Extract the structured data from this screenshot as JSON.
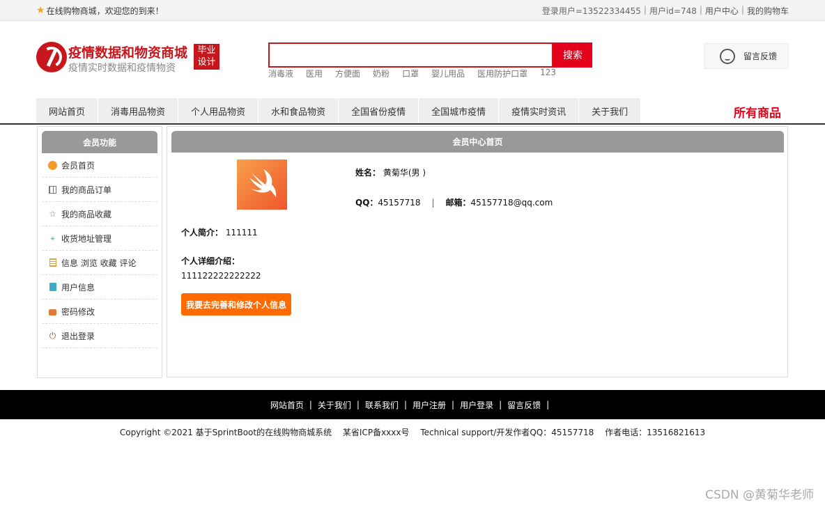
{
  "topbar": {
    "welcome": "在线购物商城，欢迎您的到来！",
    "login_user": "登录用户=13522334455",
    "user_id": "用户id=748",
    "user_center": "用户中心",
    "cart": "我的购物车"
  },
  "header": {
    "title": "疫情数据和物资商城",
    "subtitle": "疫情实时数据和疫情物资",
    "badge_line1": "毕业",
    "badge_line2": "设计",
    "search_placeholder": "",
    "search_button": "搜索",
    "hotwords": [
      "消毒液",
      "医用",
      "方便面",
      "奶粉",
      "口罩",
      "婴儿用品",
      "医用防护口罩",
      "123"
    ],
    "feedback": "留言反馈"
  },
  "nav": {
    "items": [
      "网站首页",
      "消毒用品物资",
      "个人用品物资",
      "水和食品物资",
      "全国省份疫情",
      "全国城市疫情",
      "疫情实时资讯",
      "关于我们"
    ],
    "all_goods": "所有商品"
  },
  "sidebar": {
    "title": "会员功能",
    "items": [
      {
        "label": "会员首页",
        "icon": "home-icon"
      },
      {
        "label": "我的商品订单",
        "icon": "order-icon"
      },
      {
        "label": "我的商品收藏",
        "icon": "star-icon"
      },
      {
        "label": "收货地址管理",
        "icon": "location-icon"
      },
      {
        "label": "信息 浏览 收藏 评论",
        "icon": "document-icon"
      },
      {
        "label": "用户信息",
        "icon": "clipboard-icon"
      },
      {
        "label": "密码修改",
        "icon": "lock-icon"
      },
      {
        "label": "退出登录",
        "icon": "power-icon"
      }
    ]
  },
  "main": {
    "title": "会员中心首页",
    "name_label": "姓名：",
    "name_value": "黄菊华(男 )",
    "qq_label": "QQ：",
    "qq_value": "45157718",
    "sep": "|",
    "email_label": "邮箱：",
    "email_value": "45157718@qq.com",
    "intro_label": "个人简介：",
    "intro_value": "111111",
    "detail_label": "个人详细介绍：",
    "detail_value": "111122222222222",
    "edit_button": "我要去完善和修改个人信息"
  },
  "footer": {
    "links": [
      "网站首页",
      "关于我们",
      "联系我们",
      "用户注册",
      "用户登录",
      "留言反馈"
    ],
    "sep": "|",
    "copyright": "Copyright ©2021 基于SprintBoot的在线购物商城系统",
    "icp": "某省ICP备xxxx号",
    "support": "Technical support/开发作者QQ：45157718",
    "phone": "作者电话：13516821613"
  },
  "watermark": "CSDN @黄菊华老师",
  "colors": {
    "brand": "#c8161d",
    "search": "#e4001a",
    "edit_button": "#ff6a00",
    "panel_head": "#999999"
  }
}
